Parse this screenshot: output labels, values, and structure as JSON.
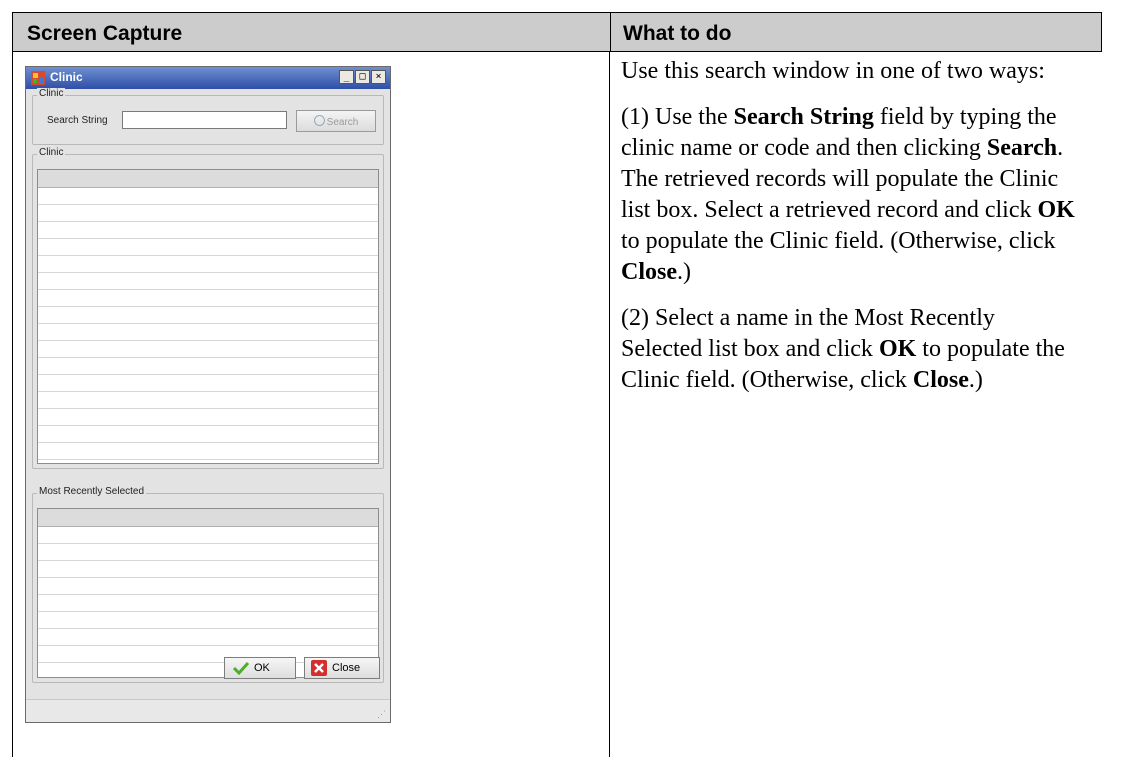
{
  "table": {
    "col_left_header": "Screen Capture",
    "col_right_header": "What to do"
  },
  "dialog": {
    "title": "Clinic",
    "search_group_label": "Clinic",
    "search_label": "Search String",
    "search_value": "",
    "search_button": "Search",
    "clinic_list_label": "Clinic",
    "recent_list_label": "Most Recently Selected",
    "ok_button": "OK",
    "close_button": "Close",
    "window_buttons": [
      "_",
      "□",
      "×"
    ]
  },
  "instructions": {
    "intro": "Use this search window in one of two ways:",
    "step1": {
      "prefix": "(1) Use the ",
      "b1": "Search String",
      "t1": " field by typing the clinic name or code and then clicking ",
      "b2": "Search",
      "t2": ". The retrieved records will populate the Clinic list box. Select a retrieved record and click ",
      "b3": "OK",
      "t3": " to populate the Clinic field. (Otherwise, click ",
      "b4": "Close",
      "t4": ".)"
    },
    "step2": {
      "prefix": "(2) Select a name in the Most Recently Selected list box and click ",
      "b1": "OK",
      "t1": " to populate the Clinic field. (Otherwise, click ",
      "b2": "Close",
      "t2": ".)"
    }
  },
  "colors": {
    "header_bg": "#cccccc",
    "titlebar": "#2e4fa6",
    "ok_check": "#4caf2a",
    "close_x": "#d32f2f"
  },
  "icons": [
    "app-icon",
    "search-icon",
    "checkmark-icon",
    "close-x-icon",
    "resize-grip-icon"
  ]
}
